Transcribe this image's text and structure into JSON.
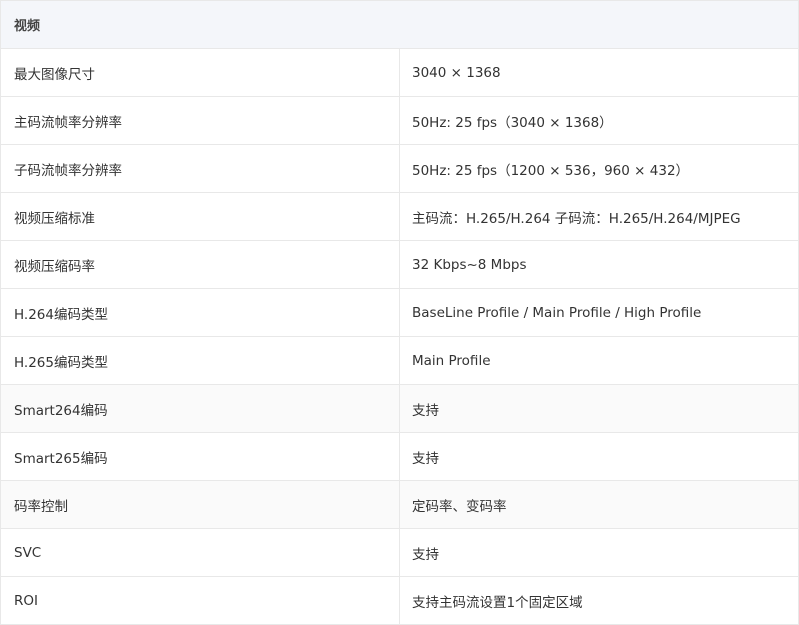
{
  "section_title": "视频",
  "rows": [
    {
      "label": "最大图像尺寸",
      "value": "3040 × 1368"
    },
    {
      "label": "主码流帧率分辨率",
      "value": "50Hz: 25 fps（3040 × 1368）"
    },
    {
      "label": "子码流帧率分辨率",
      "value": "50Hz: 25 fps（1200 × 536，960 × 432）"
    },
    {
      "label": "视频压缩标准",
      "value": "主码流：H.265/H.264 子码流：H.265/H.264/MJPEG"
    },
    {
      "label": "视频压缩码率",
      "value": "32 Kbps~8 Mbps"
    },
    {
      "label": "H.264编码类型",
      "value": "BaseLine Profile / Main Profile / High Profile"
    },
    {
      "label": "H.265编码类型",
      "value": "Main Profile"
    },
    {
      "label": "Smart264编码",
      "value": "支持"
    },
    {
      "label": "Smart265编码",
      "value": "支持"
    },
    {
      "label": "码率控制",
      "value": "定码率、变码率"
    },
    {
      "label": "SVC",
      "value": "支持"
    },
    {
      "label": "ROI",
      "value": "支持主码流设置1个固定区域"
    }
  ]
}
